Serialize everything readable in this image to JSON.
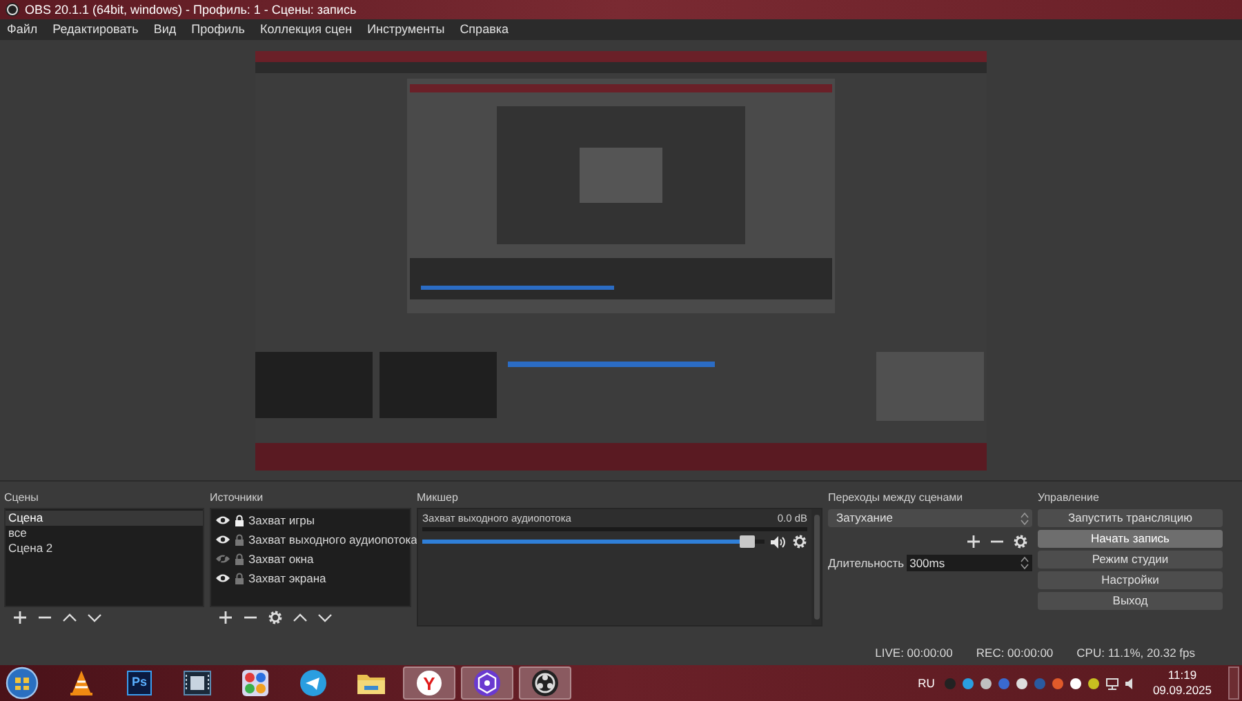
{
  "window": {
    "title": "OBS 20.1.1 (64bit, windows) - Профиль: 1 - Сцены: запись"
  },
  "menu": [
    "Файл",
    "Редактировать",
    "Вид",
    "Профиль",
    "Коллекция сцен",
    "Инструменты",
    "Справка"
  ],
  "scenes": {
    "title": "Сцены",
    "items": [
      {
        "label": "Сцена",
        "selected": true
      },
      {
        "label": "все",
        "selected": false
      },
      {
        "label": "Сцена 2",
        "selected": false
      }
    ]
  },
  "sources": {
    "title": "Источники",
    "items": [
      {
        "label": "Захват игры",
        "visible": true,
        "locked": true
      },
      {
        "label": "Захват выходного аудиопотока",
        "visible": true,
        "locked": false
      },
      {
        "label": "Захват окна",
        "visible": false,
        "locked": false
      },
      {
        "label": "Захват экрана",
        "visible": true,
        "locked": false
      }
    ]
  },
  "mixer": {
    "title": "Микшер",
    "channels": [
      {
        "name": "Захват выходного аудиопотока",
        "reading": "0.0 dB",
        "level": 0.97
      }
    ]
  },
  "transitions": {
    "title": "Переходы между сценами",
    "transition": "Затухание",
    "duration_label": "Длительность",
    "duration": "300ms"
  },
  "controls": {
    "title": "Управление",
    "buttons": [
      {
        "label": "Запустить трансляцию",
        "hovered": false
      },
      {
        "label": "Начать запись",
        "hovered": true
      },
      {
        "label": "Режим студии",
        "hovered": false
      },
      {
        "label": "Настройки",
        "hovered": false
      },
      {
        "label": "Выход",
        "hovered": false
      }
    ]
  },
  "status_bar": {
    "live": "LIVE: 00:00:00",
    "rec": "REC: 00:00:00",
    "cpu": "CPU: 11.1%, 20.32 fps"
  },
  "taskbar": {
    "apps": [
      {
        "open": false
      },
      {
        "open": false,
        "label": "Ps"
      },
      {
        "open": false
      },
      {
        "open": false
      },
      {
        "open": false
      },
      {
        "open": false
      },
      {
        "open": true,
        "label": "Y"
      },
      {
        "open": true
      },
      {
        "open": true
      }
    ],
    "language": "RU",
    "time": "11:19",
    "date": "09.09.2025"
  }
}
